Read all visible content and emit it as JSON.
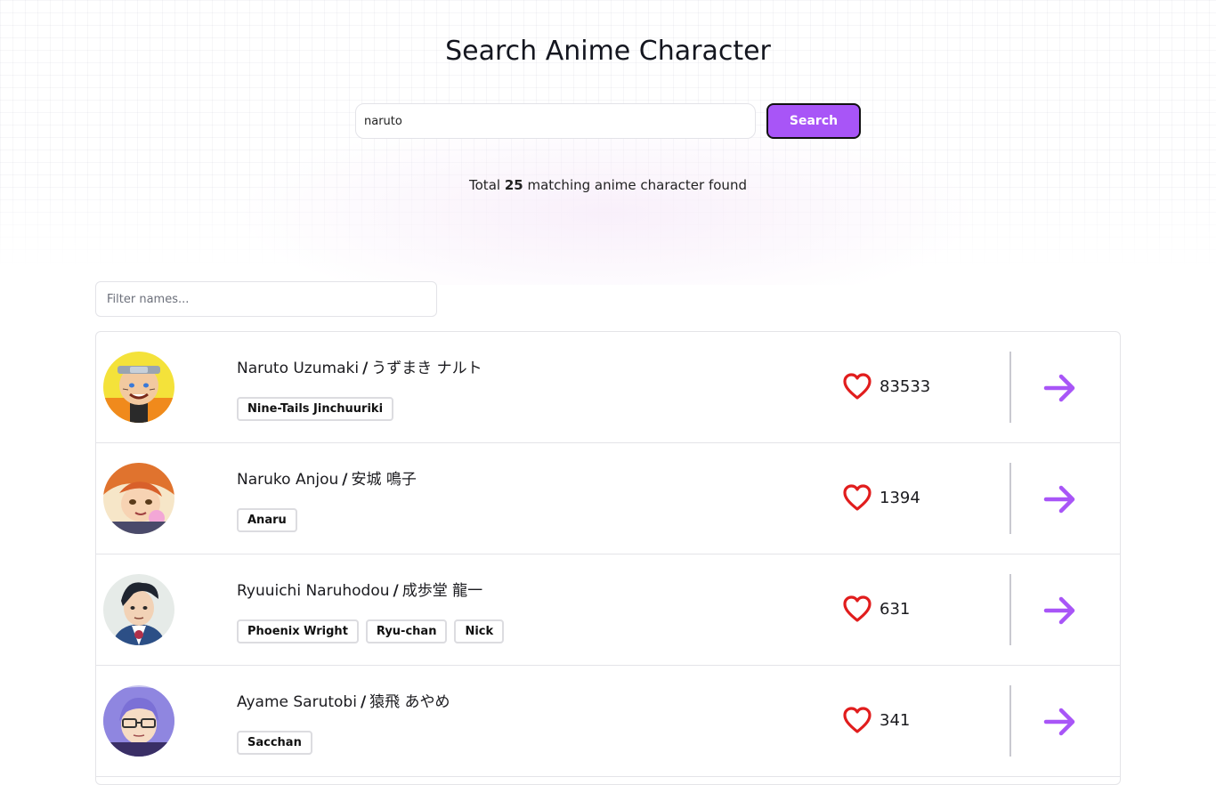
{
  "header": {
    "title": "Search Anime Character"
  },
  "search": {
    "value": "naruto",
    "button_label": "Search"
  },
  "results": {
    "prefix": "Total",
    "count": "25",
    "suffix": "matching anime character found"
  },
  "filter": {
    "placeholder": "Filter names..."
  },
  "characters": [
    {
      "name": "Naruto Uzumaki",
      "separator": "/",
      "name_kanji": "うずまき ナルト",
      "nicknames": [
        "Nine-Tails Jinchuuriki"
      ],
      "favorites": "83533",
      "avatar_icon": "naruto-avatar"
    },
    {
      "name": "Naruko Anjou",
      "separator": "/",
      "name_kanji": "安城 鳴子",
      "nicknames": [
        "Anaru"
      ],
      "favorites": "1394",
      "avatar_icon": "naruko-avatar"
    },
    {
      "name": "Ryuuichi Naruhodou",
      "separator": "/",
      "name_kanji": "成歩堂 龍一",
      "nicknames": [
        "Phoenix Wright",
        "Ryu-chan",
        "Nick"
      ],
      "favorites": "631",
      "avatar_icon": "ryuuichi-avatar"
    },
    {
      "name": "Ayame Sarutobi",
      "separator": "/",
      "name_kanji": "猿飛 あやめ",
      "nicknames": [
        "Sacchan"
      ],
      "favorites": "341",
      "avatar_icon": "ayame-avatar"
    }
  ],
  "colors": {
    "accent": "#a855f7",
    "heart": "#e11d1d",
    "arrow": "#a855f7"
  },
  "icons": {
    "favorite": "heart-icon",
    "open": "arrow-right-icon"
  }
}
